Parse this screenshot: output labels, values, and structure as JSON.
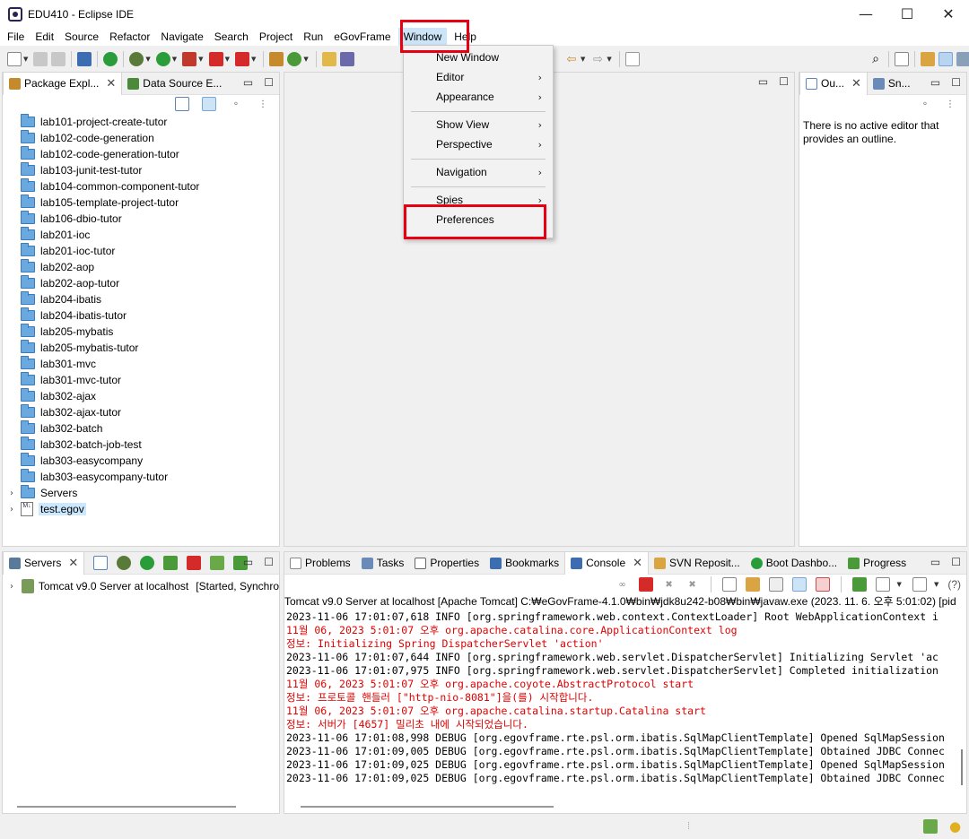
{
  "window": {
    "title": "EDU410 - Eclipse IDE",
    "minimize": "—",
    "maximize": "☐",
    "close": "✕"
  },
  "menubar": [
    "File",
    "Edit",
    "Source",
    "Refactor",
    "Navigate",
    "Search",
    "Project",
    "Run",
    "eGovFrame",
    "Window",
    "Help"
  ],
  "window_menu": {
    "items": [
      {
        "label": "New Window",
        "submenu": false
      },
      {
        "label": "Editor",
        "submenu": true
      },
      {
        "label": "Appearance",
        "submenu": true
      },
      {
        "label": "Show View",
        "submenu": true
      },
      {
        "label": "Perspective",
        "submenu": true
      },
      {
        "label": "Navigation",
        "submenu": true
      },
      {
        "label": "Spies",
        "submenu": true
      },
      {
        "label": "Preferences",
        "submenu": false
      }
    ]
  },
  "package_explorer": {
    "tabs": [
      "Package Expl...",
      "Data Source E..."
    ],
    "projects": [
      "lab101-project-create-tutor",
      "lab102-code-generation",
      "lab102-code-generation-tutor",
      "lab103-junit-test-tutor",
      "lab104-common-component-tutor",
      "lab105-template-project-tutor",
      "lab106-dbio-tutor",
      "lab201-ioc",
      "lab201-ioc-tutor",
      "lab202-aop",
      "lab202-aop-tutor",
      "lab204-ibatis",
      "lab204-ibatis-tutor",
      "lab205-mybatis",
      "lab205-mybatis-tutor",
      "lab301-mvc",
      "lab301-mvc-tutor",
      "lab302-ajax",
      "lab302-ajax-tutor",
      "lab302-batch",
      "lab302-batch-job-test",
      "lab303-easycompany",
      "lab303-easycompany-tutor"
    ],
    "servers": "Servers",
    "test_egov": "test.egov",
    "file_icon": "M↓"
  },
  "outline": {
    "tabs": [
      "Ou...",
      "Sn..."
    ],
    "message": "There is no active editor that provides an outline."
  },
  "servers_view": {
    "tab": "Servers",
    "server": "Tomcat v9.0 Server at localhost",
    "status": "[Started, Synchro"
  },
  "bottom_tabs": [
    "Problems",
    "Tasks",
    "Properties",
    "Bookmarks",
    "Console",
    "SVN Reposit...",
    "Boot Dashbo...",
    "Progress"
  ],
  "console": {
    "header": "Tomcat v9.0 Server at localhost [Apache Tomcat] C:₩eGovFrame-4.1.0₩bin₩jdk8u242-b08₩bin₩javaw.exe  (2023. 11. 6. 오후 5:01:02) [pid",
    "help": "(?)",
    "lines": [
      {
        "text": "2023-11-06 17:01:07,618  INFO [org.springframework.web.context.ContextLoader] Root WebApplicationContext i",
        "red": false
      },
      {
        "text": "11월 06, 2023 5:01:07 오후 org.apache.catalina.core.ApplicationContext log",
        "red": true
      },
      {
        "text": "정보: Initializing Spring DispatcherServlet 'action'",
        "red": true
      },
      {
        "text": "2023-11-06 17:01:07,644  INFO [org.springframework.web.servlet.DispatcherServlet] Initializing Servlet 'ac",
        "red": false
      },
      {
        "text": "2023-11-06 17:01:07,975  INFO [org.springframework.web.servlet.DispatcherServlet] Completed initialization",
        "red": false
      },
      {
        "text": "11월 06, 2023 5:01:07 오후 org.apache.coyote.AbstractProtocol start",
        "red": true
      },
      {
        "text": "정보: 프로토콜 핸들러 [\"http-nio-8081\"]을(를) 시작합니다.",
        "red": true
      },
      {
        "text": "11월 06, 2023 5:01:07 오후 org.apache.catalina.startup.Catalina start",
        "red": true
      },
      {
        "text": "정보: 서버가 [4657] 밀리초 내에 시작되었습니다.",
        "red": true
      },
      {
        "text": "2023-11-06 17:01:08,998 DEBUG [org.egovframe.rte.psl.orm.ibatis.SqlMapClientTemplate] Opened SqlMapSession",
        "red": false
      },
      {
        "text": "2023-11-06 17:01:09,005 DEBUG [org.egovframe.rte.psl.orm.ibatis.SqlMapClientTemplate] Obtained JDBC Connec",
        "red": false
      },
      {
        "text": "2023-11-06 17:01:09,025 DEBUG [org.egovframe.rte.psl.orm.ibatis.SqlMapClientTemplate] Opened SqlMapSession",
        "red": false
      },
      {
        "text": "2023-11-06 17:01:09,025 DEBUG [org.egovframe.rte.psl.orm.ibatis.SqlMapClientTemplate] Obtained JDBC Connec",
        "red": false
      }
    ]
  },
  "colors": {
    "highlight": "#e60012",
    "console_red": "#e00000",
    "selection": "#cce8ff"
  }
}
